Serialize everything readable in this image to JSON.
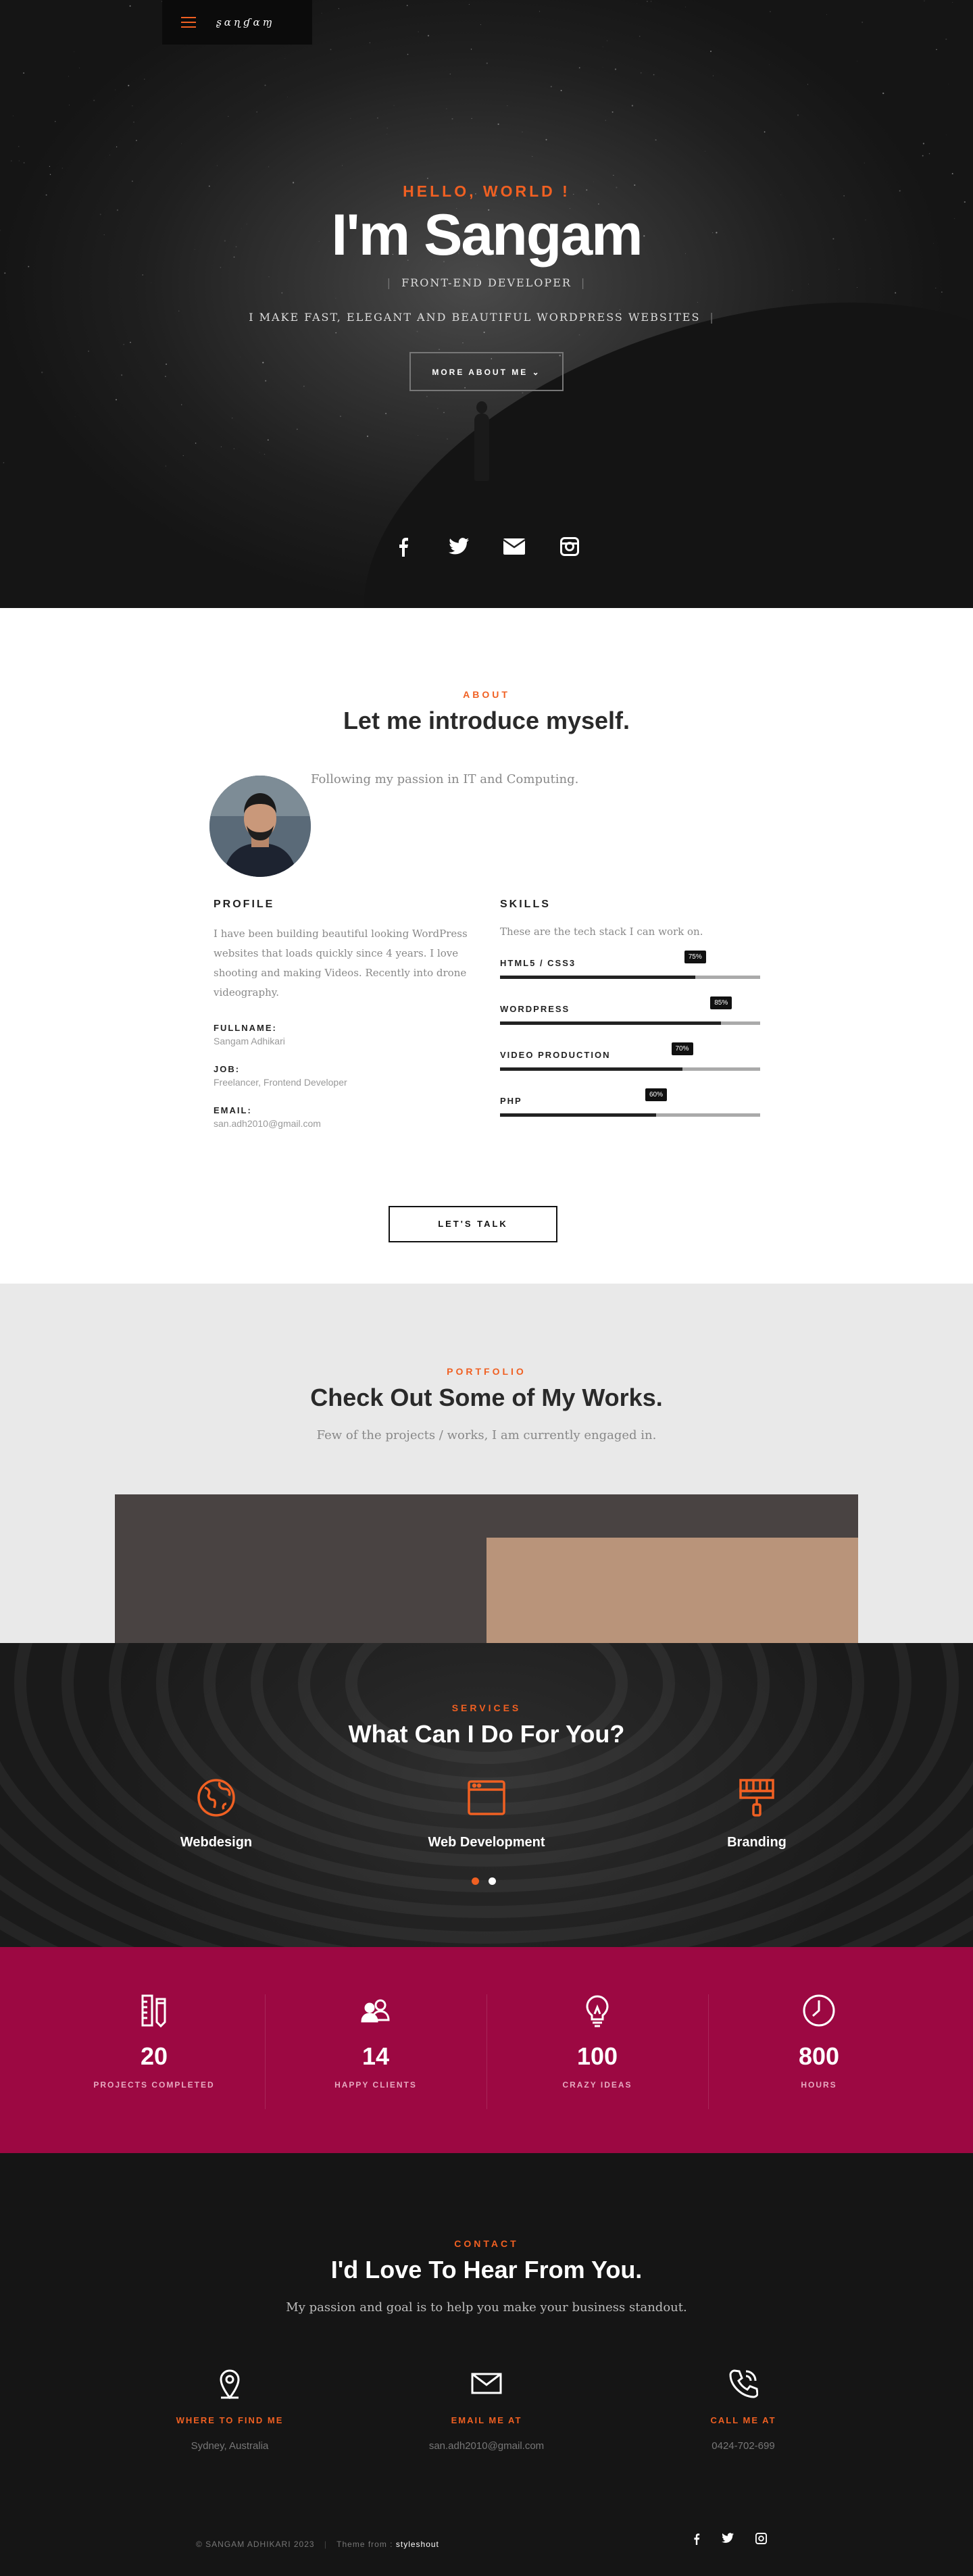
{
  "nav": {
    "logo": "ʂɑɳɠɑɱ"
  },
  "hero": {
    "hello": "HELLO, WORLD !",
    "name": "I'm Sangam",
    "role": "FRONT-END DEVELOPER",
    "tagline": "I MAKE FAST, ELEGANT AND BEAUTIFUL WORDPRESS WEBSITES",
    "button": "MORE ABOUT ME",
    "social": [
      "facebook-icon",
      "twitter-icon",
      "envelope-icon",
      "instagram-icon"
    ]
  },
  "about": {
    "kicker": "ABOUT",
    "title": "Let me introduce myself.",
    "intro": "Following my passion in IT and Computing.",
    "profile": {
      "title": "PROFILE",
      "text": "I have been building beautiful looking WordPress websites that loads quickly since 4 years. I love shooting and making Videos. Recently into drone videography.",
      "fullname_label": "FULLNAME:",
      "fullname": "Sangam Adhikari",
      "job_label": "JOB:",
      "job": "Freelancer, Frontend Developer",
      "email_label": "EMAIL:",
      "email": "san.adh2010@gmail.com"
    },
    "skills": {
      "title": "SKILLS",
      "lead": "These are the tech stack I can work on.",
      "items": [
        {
          "name": "HTML5 / CSS3",
          "percent": 75,
          "label": "75%"
        },
        {
          "name": "WORDPRESS",
          "percent": 85,
          "label": "85%"
        },
        {
          "name": "VIDEO PRODUCTION",
          "percent": 70,
          "label": "70%"
        },
        {
          "name": "PHP",
          "percent": 60,
          "label": "60%"
        }
      ]
    },
    "button": "LET'S TALK"
  },
  "portfolio": {
    "kicker": "PORTFOLIO",
    "title": "Check Out Some of My Works.",
    "subtitle": "Few of the projects / works, I am currently engaged in."
  },
  "services": {
    "kicker": "SERVICES",
    "title": "What Can I Do For You?",
    "items": [
      {
        "label": "Webdesign",
        "icon": "globe-icon"
      },
      {
        "label": "Web Development",
        "icon": "browser-window-icon"
      },
      {
        "label": "Branding",
        "icon": "paint-brush-icon"
      }
    ]
  },
  "stats": {
    "items": [
      {
        "num": "20",
        "label": "PROJECTS COMPLETED",
        "icon": "ruler-pencil-icon"
      },
      {
        "num": "14",
        "label": "HAPPY CLIENTS",
        "icon": "users-icon"
      },
      {
        "num": "100",
        "label": "CRAZY IDEAS",
        "icon": "lightbulb-icon"
      },
      {
        "num": "800",
        "label": "HOURS",
        "icon": "clock-icon"
      }
    ]
  },
  "contact": {
    "kicker": "CONTACT",
    "title": "I'd Love To Hear From You.",
    "subtitle": "My passion and goal is to help you make your business standout.",
    "items": [
      {
        "label": "WHERE TO FIND ME",
        "value": "Sydney, Australia",
        "icon": "map-pin-icon"
      },
      {
        "label": "EMAIL ME AT",
        "value": "san.adh2010@gmail.com",
        "icon": "envelope-icon"
      },
      {
        "label": "CALL ME AT",
        "value": "0424-702-699",
        "icon": "phone-icon"
      }
    ]
  },
  "footer": {
    "copyright": "© SANGAM ADHIKARI 2023",
    "theme_label": "Theme from :",
    "theme": "styleshout",
    "social": [
      "facebook-icon",
      "twitter-icon",
      "instagram-icon"
    ]
  },
  "colors": {
    "accent": "#f06022",
    "stats_bg": "#9c0842",
    "dark": "#151515"
  }
}
